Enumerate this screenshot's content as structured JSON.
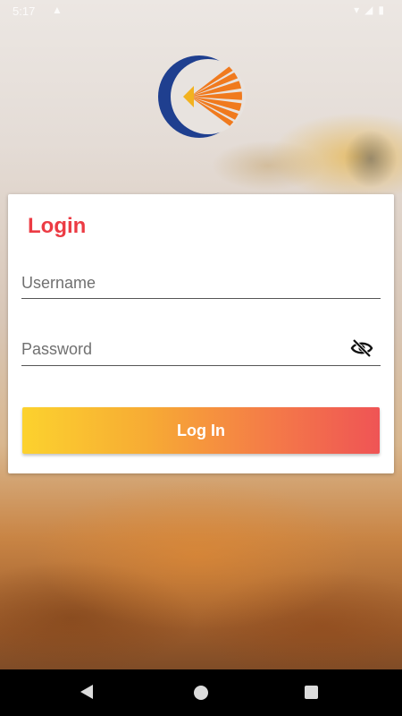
{
  "status_bar": {
    "time": "5:17",
    "alert_icon": "warning-icon",
    "right_icons": [
      "wifi-icon",
      "signal-icon",
      "battery-icon"
    ]
  },
  "logo": {
    "icon": "sun-crescent-logo",
    "colors": {
      "crescent": "#1f3f8f",
      "rays": "#f07a1e",
      "core": "#f2b21f"
    }
  },
  "login_card": {
    "title": "Login",
    "username": {
      "placeholder": "Username",
      "value": ""
    },
    "password": {
      "placeholder": "Password",
      "value": "",
      "toggle_icon": "eye-off-icon"
    },
    "submit_label": "Log In",
    "colors": {
      "title": "#ec3b44",
      "button_start": "#fcd22e",
      "button_end": "#ef5455"
    }
  },
  "nav_bar": {
    "back_icon": "back-icon",
    "home_icon": "home-icon",
    "recents_icon": "recents-icon"
  }
}
